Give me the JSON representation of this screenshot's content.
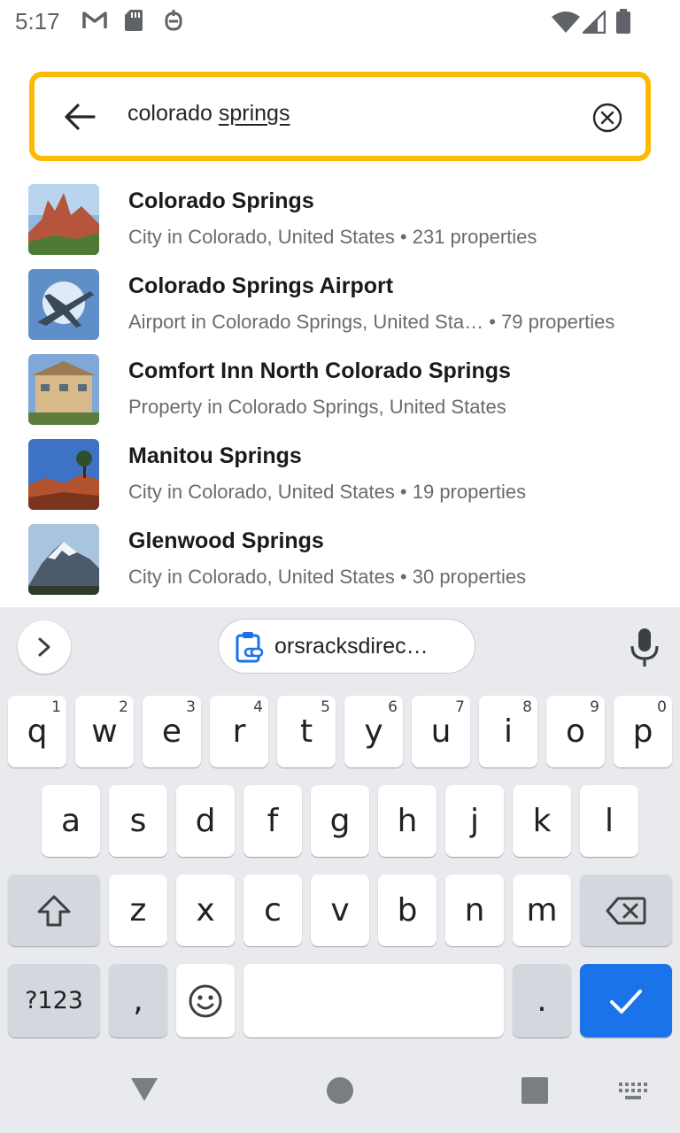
{
  "status_bar": {
    "time": "5:17",
    "icons": [
      "gmail-icon",
      "sd-card-icon",
      "accessibility-icon",
      "wifi-icon",
      "signal-icon",
      "battery-icon"
    ]
  },
  "search": {
    "query_prefix": "colorado ",
    "query_composing": "springs",
    "border_color": "#feba02"
  },
  "results": [
    {
      "title": "Colorado Springs",
      "subtitle": "City in Colorado, United States • 231 properties"
    },
    {
      "title": "Colorado Springs Airport",
      "subtitle": "Airport in Colorado Springs, United Sta…  • 79 properties"
    },
    {
      "title": "Comfort Inn North Colorado Springs",
      "subtitle": "Property in Colorado Springs, United States"
    },
    {
      "title": "Manitou Springs",
      "subtitle": "City in Colorado, United States • 19 properties"
    },
    {
      "title": "Glenwood Springs",
      "subtitle": "City in Colorado, United States • 30 properties"
    }
  ],
  "keyboard": {
    "clipboard_chip": "orsracksdirec…",
    "row1": [
      {
        "k": "q",
        "h": "1"
      },
      {
        "k": "w",
        "h": "2"
      },
      {
        "k": "e",
        "h": "3"
      },
      {
        "k": "r",
        "h": "4"
      },
      {
        "k": "t",
        "h": "5"
      },
      {
        "k": "y",
        "h": "6"
      },
      {
        "k": "u",
        "h": "7"
      },
      {
        "k": "i",
        "h": "8"
      },
      {
        "k": "o",
        "h": "9"
      },
      {
        "k": "p",
        "h": "0"
      }
    ],
    "row2": [
      "a",
      "s",
      "d",
      "f",
      "g",
      "h",
      "j",
      "k",
      "l"
    ],
    "row3": [
      "z",
      "x",
      "c",
      "v",
      "b",
      "n",
      "m"
    ],
    "symbols_label": "?123",
    "comma_label": ",",
    "period_label": ".",
    "enter_color": "#1a73e8"
  }
}
